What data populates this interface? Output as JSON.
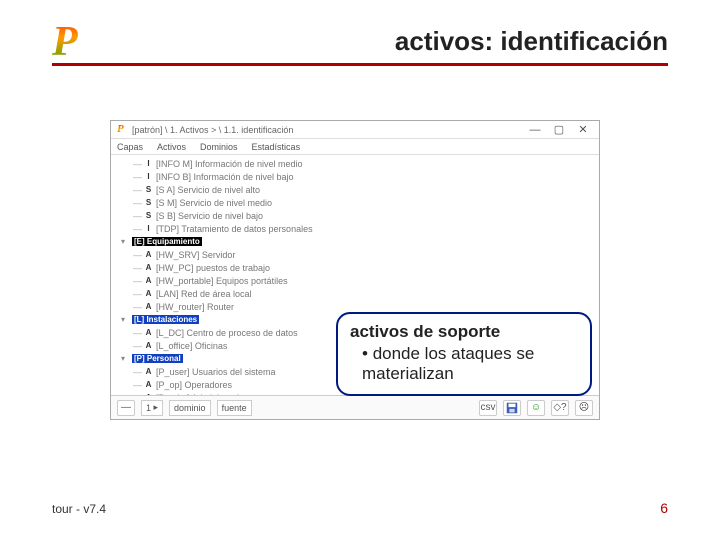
{
  "slide": {
    "title": "activos: identificación",
    "footer_left": "tour - v7.4",
    "footer_right": "6"
  },
  "callout": {
    "title": "activos de soporte",
    "bullet1": "donde los ataques se materializan"
  },
  "window": {
    "title": "[patrón] \\ 1. Activos > \\ 1.1. identificación",
    "ctrl_min": "—",
    "ctrl_max": "▢",
    "ctrl_close": "✕",
    "menu": {
      "m1": "Capas",
      "m2": "Activos",
      "m3": "Dominios",
      "m4": "Estadísticas"
    },
    "toolbar": {
      "layer": "—",
      "count": "1",
      "field1": "dominio",
      "field2": "fuente",
      "csv": "csv"
    }
  },
  "tree": {
    "items": [
      {
        "indent": 1,
        "tag": "I",
        "label": "[INFO M] Información de nivel medio"
      },
      {
        "indent": 1,
        "tag": "I",
        "label": "[INFO B] Información de nivel bajo"
      },
      {
        "indent": 1,
        "tag": "S",
        "label": "[S A] Servicio de nivel alto"
      },
      {
        "indent": 1,
        "tag": "S",
        "label": "[S M] Servicio de nivel medio"
      },
      {
        "indent": 1,
        "tag": "S",
        "label": "[S B] Servicio de nivel bajo"
      },
      {
        "indent": 1,
        "tag": "I",
        "label": "[TDP] Tratamiento de datos personales"
      },
      {
        "indent": 0,
        "hl": "black",
        "expander": "▾",
        "label": "[E] Equipamiento"
      },
      {
        "indent": 1,
        "tag": "A",
        "label": "[HW_SRV] Servidor"
      },
      {
        "indent": 1,
        "tag": "A",
        "label": "[HW_PC] puestos de trabajo"
      },
      {
        "indent": 1,
        "tag": "A",
        "label": "[HW_portable] Equipos portátiles"
      },
      {
        "indent": 1,
        "tag": "A",
        "label": "[LAN] Red de área local"
      },
      {
        "indent": 1,
        "tag": "A",
        "label": "[HW_router] Router"
      },
      {
        "indent": 0,
        "hl": "blue",
        "expander": "▾",
        "label": "[L] Instalaciones"
      },
      {
        "indent": 1,
        "tag": "A",
        "label": "[L_DC] Centro de proceso de datos"
      },
      {
        "indent": 1,
        "tag": "A",
        "label": "[L_office] Oficinas"
      },
      {
        "indent": 0,
        "hl": "blue",
        "expander": "▾",
        "label": "[P] Personal"
      },
      {
        "indent": 1,
        "tag": "A",
        "label": "[P_user] Usuarios del sistema"
      },
      {
        "indent": 1,
        "tag": "A",
        "label": "[P_op] Operadores"
      },
      {
        "indent": 1,
        "tag": "A",
        "label": "[P_adm] Administradores"
      }
    ]
  }
}
